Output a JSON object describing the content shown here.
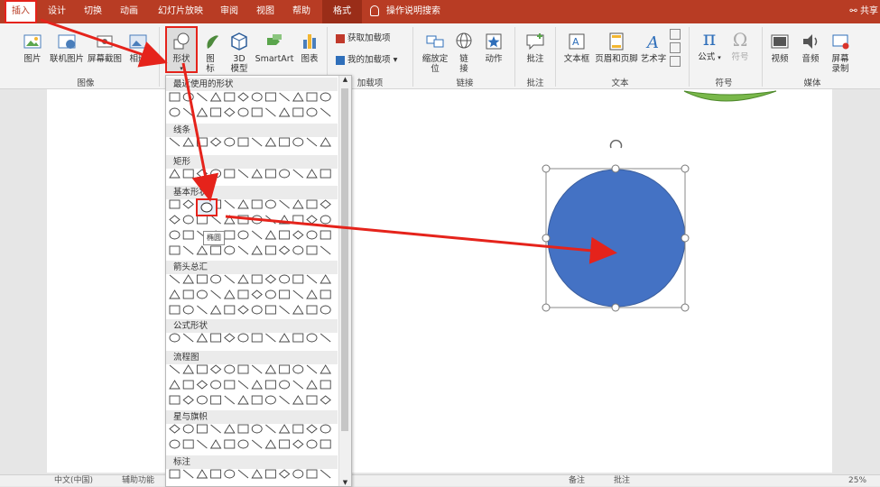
{
  "tabs": [
    {
      "label": "插入",
      "active": true
    },
    {
      "label": "设计"
    },
    {
      "label": "切换"
    },
    {
      "label": "动画"
    },
    {
      "label": "幻灯片放映"
    },
    {
      "label": "审阅"
    },
    {
      "label": "视图"
    },
    {
      "label": "帮助"
    },
    {
      "label": "格式",
      "contextual": true
    }
  ],
  "tell_me": "操作说明搜索",
  "share": "共享",
  "ribbon": {
    "buttons": {
      "picture": "图片",
      "online_picture": "联机图片",
      "screenshot": "屏幕截图",
      "album": "相册",
      "shapes": "形状",
      "icons_line1": "图",
      "icons_line2": "标",
      "model3d_line1": "3D",
      "model3d_line2": "模型",
      "smartart": "SmartArt",
      "chart": "图表",
      "get_addins": "获取加载项",
      "my_addins": "我的加载项",
      "zoom_line1": "缩放定",
      "zoom_line2": "位",
      "link_line1": "链",
      "link_line2": "接",
      "action": "动作",
      "comment": "批注",
      "textbox": "文本框",
      "header_footer": "页眉和页脚",
      "wordart": "艺术字",
      "equation": "公式",
      "symbol": "符号",
      "video": "视频",
      "audio": "音频",
      "screen_rec_line1": "屏幕",
      "screen_rec_line2": "录制"
    },
    "groups": {
      "images": "图像",
      "addins": "加载项",
      "links": "链接",
      "comments": "批注",
      "text": "文本",
      "symbols": "符号",
      "media": "媒体"
    }
  },
  "gallery": {
    "categories": [
      "最近使用的形状",
      "线条",
      "矩形",
      "基本形状",
      "箭头总汇",
      "公式形状",
      "流程图",
      "星与旗帜",
      "标注"
    ],
    "tooltip": "椭圆"
  },
  "status": {
    "left": "中文(中国)",
    "accessibility": "辅助功能",
    "notes": "备注",
    "comments": "批注",
    "zoom": "25%"
  },
  "colors": {
    "accent": "#b83c24",
    "circle_fill": "#4472c4",
    "annotation": "#e5231b",
    "leaf": "#79b84a"
  }
}
